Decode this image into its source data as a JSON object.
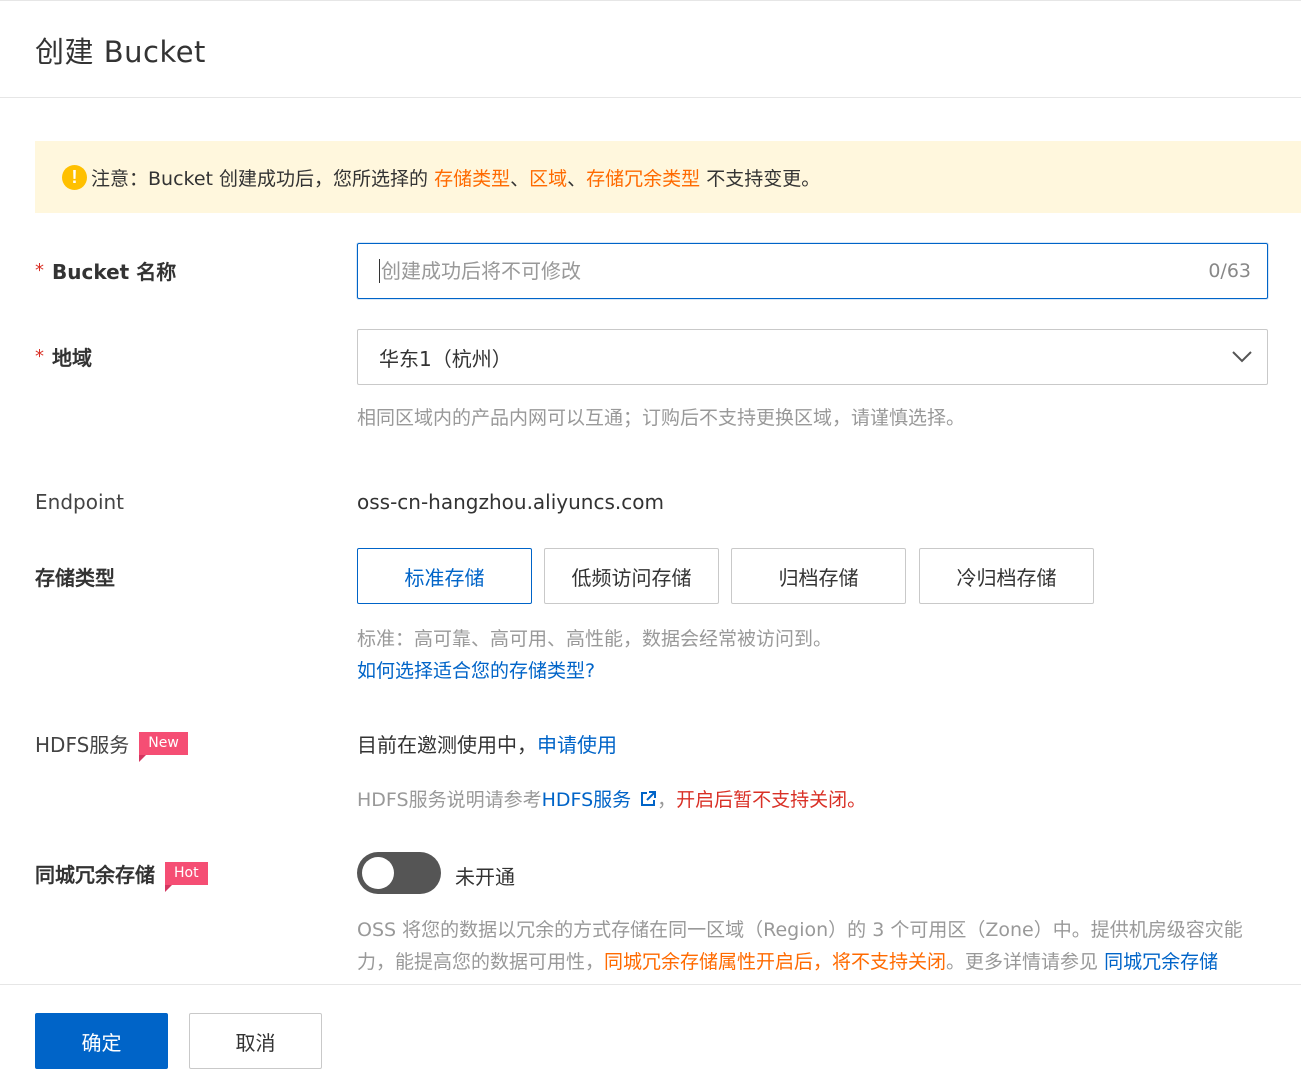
{
  "header": {
    "title": "创建 Bucket"
  },
  "notice": {
    "prefix": "注意：Bucket 创建成功后，您所选择的 ",
    "item1": "存储类型",
    "sep1": "、",
    "item2": "区域",
    "sep2": "、",
    "item3": "存储冗余类型",
    "suffix": " 不支持变更。"
  },
  "bucket_name": {
    "label": "Bucket 名称",
    "required_mark": "*",
    "placeholder": "创建成功后将不可修改",
    "value": "",
    "counter": "0/63"
  },
  "region": {
    "label": "地域",
    "required_mark": "*",
    "selected": "华东1（杭州）",
    "hint": "相同区域内的产品内网可以互通；订购后不支持更换区域，请谨慎选择。"
  },
  "endpoint": {
    "label": "Endpoint",
    "value": "oss-cn-hangzhou.aliyuncs.com"
  },
  "storage_type": {
    "label": "存储类型",
    "options": [
      "标准存储",
      "低频访问存储",
      "归档存储",
      "冷归档存储"
    ],
    "selected_index": 0,
    "hint": "标准：高可靠、高可用、高性能，数据会经常被访问到。",
    "help_link": "如何选择适合您的存储类型?"
  },
  "hdfs": {
    "label": "HDFS服务",
    "tag": "New",
    "status_text": "目前在邀测使用中，",
    "apply_link": "申请使用",
    "note_prefix": "HDFS服务说明请参考",
    "note_link": "HDFS服务",
    "note_sep": "，",
    "note_warning": "开启后暂不支持关闭。"
  },
  "redundancy": {
    "label": "同城冗余存储",
    "tag": "Hot",
    "enabled": false,
    "toggle_label": "未开通",
    "desc_part1": "OSS 将您的数据以冗余的方式存储在同一区域（Region）的 3 个可用区（Zone）中。提供机房级容灾能力，能提高您的数据可用性，",
    "desc_warning": "同城冗余存储属性开启后，将不支持关闭",
    "desc_part2": "。更多详情请参见 ",
    "desc_link": "同城冗余存储"
  },
  "footer": {
    "confirm": "确定",
    "cancel": "取消"
  },
  "colors": {
    "primary": "#0064c8",
    "warning": "#ff6a00",
    "danger": "#d93026",
    "notice_bg": "#fff7dd",
    "tag_bg": "#f54e74"
  }
}
